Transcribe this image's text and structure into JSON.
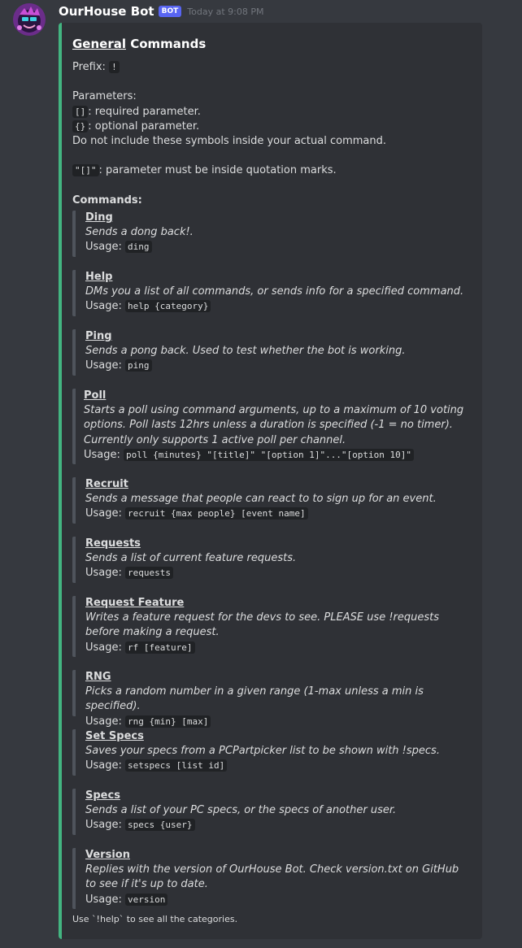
{
  "message": {
    "author": "OurHouse Bot",
    "badge": "BOT",
    "timestamp": "Today at 9:08 PM",
    "accent_color": "#43b581"
  },
  "embed": {
    "title_underlined": "General",
    "title_rest": " Commands",
    "prefix_label": "Prefix: ",
    "prefix_value": "!",
    "parameters_label": "Parameters:",
    "required_code": "[]",
    "required_text": ": required parameter.",
    "optional_code": "{}",
    "optional_text": ": optional parameter.",
    "note": "Do not include these symbols inside your actual command.",
    "quote_code": "\"[]\"",
    "quote_text": ": parameter must be inside quotation marks.",
    "commands_label": "Commands:",
    "usage_label": "Usage: ",
    "commands": [
      {
        "name": "Ding",
        "description": "Sends a dong back!.",
        "usage": "ding"
      },
      {
        "name": "Help",
        "description": "DMs you a list of all commands, or sends info for a specified command.",
        "usage": "help {category}"
      },
      {
        "name": "Ping",
        "description": "Sends a pong back. Used to test whether the bot is working.",
        "usage": "ping"
      },
      {
        "name": "Poll",
        "description": "Starts a poll using command arguments, up to a maximum of 10 voting options. Poll lasts 12hrs unless a duration is specified (-1 = no timer). Currently only supports 1 active poll per channel.",
        "usage": "poll {minutes} \"[title]\" \"[option 1]\"...\"[option 10]\""
      },
      {
        "name": "Recruit",
        "description": "Sends a message that people can react to to sign up for an event.",
        "usage": "recruit {max people} [event name]"
      },
      {
        "name": "Requests",
        "description": "Sends a list of current feature requests.",
        "usage": "requests"
      },
      {
        "name": "Request Feature",
        "description": "Writes a feature request for the devs to see. PLEASE use !requests before making a request.",
        "usage": "rf [feature]"
      },
      {
        "name": "RNG",
        "description": "Picks a random number in a given range (1-max unless a min is specified).",
        "usage": "rng {min} [max]"
      },
      {
        "name": "Set Specs",
        "description": "Saves your specs from a PCPartpicker list to be shown with !specs.",
        "usage": "setspecs [list id]"
      },
      {
        "name": "Specs",
        "description": "Sends a list of your PC specs, or the specs of another user.",
        "usage": "specs {user}"
      },
      {
        "name": "Version",
        "description": "Replies with the version of OurHouse Bot. Check version.txt on GitHub to see if it's up to date.",
        "usage": "version"
      }
    ],
    "footer": "Use `!help` to see all the categories."
  }
}
